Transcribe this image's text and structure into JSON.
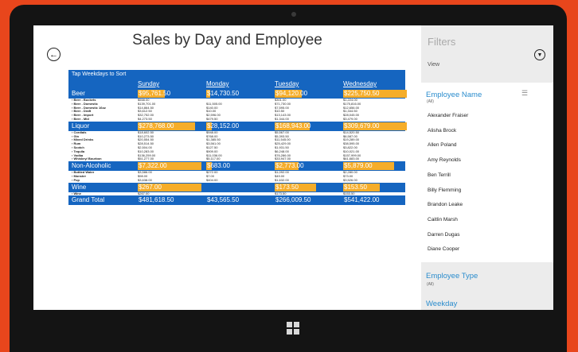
{
  "page": {
    "title": "Sales by Day and Employee"
  },
  "table": {
    "tap_label": "Tap Weekdays to Sort",
    "days": [
      "Sunday",
      "Monday",
      "Tuesday",
      "Wednesday"
    ],
    "groups": [
      {
        "name": "Beer",
        "totals": [
          "$95,761.50",
          "$14,730.50",
          "$94,120.00",
          "$225,750.50"
        ],
        "bars": [
          0.42,
          0.06,
          0.42,
          1.0
        ],
        "items": [
          {
            "name": "› Beer - Buckets",
            "values": [
              "$558.00",
              "",
              "$301.00",
              "$1,224.00"
            ]
          },
          {
            "name": "› Beer - Domestic",
            "values": [
              "$139,701.00",
              "$11,505.00",
              "$71,730.00",
              "$175,816.00"
            ]
          },
          {
            "name": "› Beer - Domestic 16oz",
            "values": [
              "$14,864.50",
              "$140.00",
              "$7,595.00",
              "$12,656.00"
            ]
          },
          {
            "name": "› Beer - Draft",
            "values": [
              "$3,612.50",
              "$10.00",
              "$10.50",
              "$1,344.50"
            ]
          },
          {
            "name": "› Beer - Import",
            "values": [
              "$32,752.00",
              "$2,596.00",
              "$13,143.00",
              "$28,045.00"
            ]
          },
          {
            "name": "› Beer - Mid",
            "values": [
              "$4,273.50",
              "$479.50",
              "$1,344.00",
              "$3,479.00"
            ]
          }
        ]
      },
      {
        "name": "Liquor",
        "totals": [
          "$278,768.00",
          "$28,152.00",
          "$168,943.00",
          "$309,679.00"
        ],
        "bars": [
          0.9,
          0.09,
          0.55,
          1.0
        ],
        "items": [
          {
            "name": "› Cordials",
            "values": [
              "$18,602.50",
              "$948.00",
              "$5,567.00",
              "$14,520.50"
            ]
          },
          {
            "name": "› Gin",
            "values": [
              "$10,273.50",
              "$768.00",
              "$5,393.50",
              "$6,587.00"
            ]
          },
          {
            "name": "› Mixed Drinks",
            "values": [
              "$20,554.50",
              "$1,385.50",
              "$11,545.00",
              "$19,289.00"
            ]
          },
          {
            "name": "› Rum",
            "values": [
              "$28,514.50",
              "$3,561.00",
              "$25,429.00",
              "$38,595.00"
            ]
          },
          {
            "name": "› Scotch",
            "values": [
              "$2,504.00",
              "$127.50",
              "$1,931.50",
              "$3,822.00"
            ]
          },
          {
            "name": "› Tequila",
            "values": [
              "$10,283.00",
              "$909.00",
              "$6,248.00",
              "$10,021.00"
            ]
          },
          {
            "name": "› Vodka",
            "values": [
              "$136,259.00",
              "$11,036.00",
              "$76,286.00",
              "$157,999.00"
            ]
          },
          {
            "name": "› Whiskey/ Bourbon",
            "values": [
              "$51,277.00",
              "$5,117.00",
              "$33,947.00",
              "$61,683.00"
            ]
          }
        ]
      },
      {
        "name": "Non-Alcoholic",
        "totals": [
          "$7,322.00",
          "$683.00",
          "$2,773.00",
          "$5,879.00"
        ],
        "bars": [
          1.0,
          0.09,
          0.38,
          0.8
        ],
        "items": [
          {
            "name": "› Bottled Water",
            "values": [
              "$3,586.00",
              "$272.00",
              "$1,092.00",
              "$2,280.00"
            ]
          },
          {
            "name": "› Monster",
            "values": [
              "$98.00",
              "$7.00",
              "$49.00",
              "$73.00"
            ]
          },
          {
            "name": "› Pop",
            "values": [
              "$3,638.00",
              "$404.00",
              "$1,632.00",
              "$3,526.00"
            ]
          }
        ]
      },
      {
        "name": "Wine",
        "totals": [
          "$267.00",
          "",
          "$173.50",
          "$153.50"
        ],
        "bars": [
          1.0,
          0,
          0.65,
          0.58
        ],
        "items": [
          {
            "name": "› Wine",
            "values": [
              "$267.00",
              "",
              "$173.50",
              "$153.50"
            ]
          }
        ]
      }
    ],
    "grand_total": {
      "label": "Grand Total",
      "values": [
        "$481,618.50",
        "$43,565.50",
        "$266,009.50",
        "$541,422.00"
      ]
    }
  },
  "filters": {
    "title": "Filters",
    "view_label": "View",
    "employee_header": "Employee Name",
    "employee_all": "(All)",
    "employees": [
      "Alexander Fraiser",
      "Alisha Brock",
      "Allen Poland",
      "Amy Reynolds",
      "Ben Terrill",
      "Billy Flemming",
      "Brandon Leake",
      "Caitlin Marsh",
      "Darren Dugas",
      "Diane Cooper"
    ],
    "employee_type_header": "Employee Type",
    "employee_type_all": "(All)",
    "weekday_header": "Weekday"
  },
  "colors": {
    "accent": "#1565c0",
    "bar": "#f5ad2a",
    "filter_header": "#2a8ccd",
    "background": "#e8461c"
  }
}
